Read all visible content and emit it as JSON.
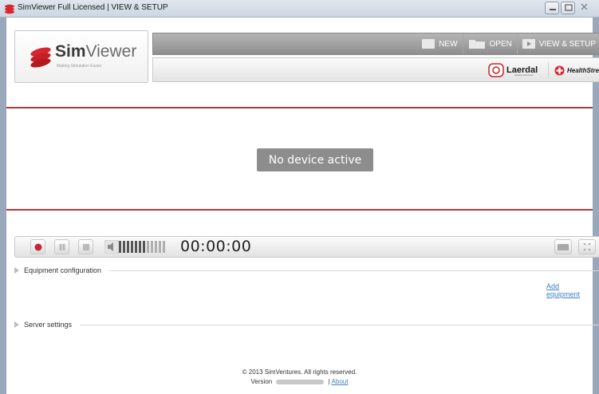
{
  "window": {
    "title": "SimViewer Full Licensed | VIEW & SETUP"
  },
  "logo": {
    "name_bold": "Sim",
    "name_light": "Viewer",
    "tagline": "Making Simulation Easier"
  },
  "toolbar": {
    "new_label": "NEW",
    "open_label": "OPEN",
    "view_setup_label": "VIEW & SETUP"
  },
  "partners": {
    "laerdal": "Laerdal",
    "laerdal_tagline": "helping save lives",
    "healthstream": "HealthStream"
  },
  "stage": {
    "status": "No device active"
  },
  "controls": {
    "timer": "00:00:00",
    "volume_bars_on": 7,
    "volume_bars_total": 12
  },
  "sections": {
    "equipment": "Equipment configuration",
    "add_equipment": "Add equipment",
    "server": "Server settings"
  },
  "footer": {
    "copyright": "© 2013 SimVentures. All rights reserved.",
    "version_label": "Version",
    "about": "About"
  },
  "colors": {
    "accent_red": "#a93c3c",
    "link_blue": "#3f80c8",
    "record_red": "#c2283a"
  }
}
